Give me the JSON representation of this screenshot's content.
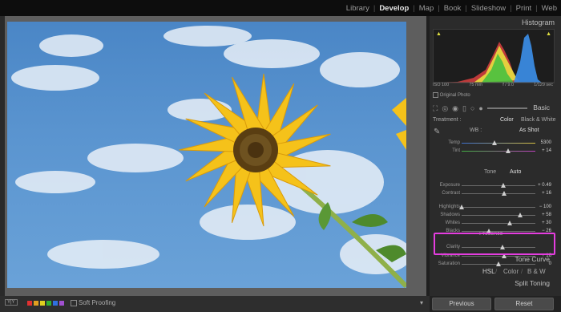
{
  "modules": [
    "Library",
    "Develop",
    "Map",
    "Book",
    "Slideshow",
    "Print",
    "Web"
  ],
  "active_module": "Develop",
  "histogram": {
    "title": "Histogram",
    "info": [
      "ISO 100",
      "75 mm",
      "f / 9.0",
      "1/129 sec"
    ],
    "original_photo": "Original Photo"
  },
  "basic": {
    "title": "Basic",
    "treatment_label": "Treatment :",
    "treatment_options": [
      "Color",
      "Black & White"
    ],
    "wb_label": "WB :",
    "wb_value": "As Shot",
    "tone_label": "Tone",
    "tone_auto": "Auto",
    "presence_label": "Presence",
    "sliders": [
      {
        "name": "Temp",
        "value": "5300",
        "pos": 0.45,
        "group": "wb"
      },
      {
        "name": "Tint",
        "value": "+ 14",
        "pos": 0.63,
        "group": "wb"
      },
      {
        "name": "Exposure",
        "value": "+ 0.49",
        "pos": 0.56,
        "group": "tone"
      },
      {
        "name": "Contrast",
        "value": "+ 16",
        "pos": 0.58,
        "group": "tone"
      },
      {
        "name": "Highlights",
        "value": "− 100",
        "pos": 0.0,
        "group": "tone"
      },
      {
        "name": "Shadows",
        "value": "+ 58",
        "pos": 0.79,
        "group": "tone"
      },
      {
        "name": "Whites",
        "value": "+ 30",
        "pos": 0.65,
        "group": "tone"
      },
      {
        "name": "Blacks",
        "value": "− 26",
        "pos": 0.37,
        "group": "tone"
      },
      {
        "name": "Clarity",
        "value": "",
        "pos": 0.55,
        "group": "presence"
      },
      {
        "name": "Vibrance",
        "value": "+ 16",
        "pos": 0.58,
        "group": "presence"
      },
      {
        "name": "Saturation",
        "value": "0",
        "pos": 0.5,
        "group": "presence"
      }
    ]
  },
  "sections": {
    "tone_curve": "Tone Curve",
    "hsl": "HSL",
    "color": "Color",
    "bw": "B & W",
    "split_toning": "Split Toning"
  },
  "buttons": {
    "previous": "Previous",
    "reset": "Reset"
  },
  "filmstrip": {
    "soft_proofing": "Soft Proofing"
  },
  "colors": {
    "highlight": "#e53de0",
    "swatches": [
      "#e03131",
      "#e0a020",
      "#e0d020",
      "#30b030",
      "#3070e0",
      "#a050d0"
    ]
  }
}
